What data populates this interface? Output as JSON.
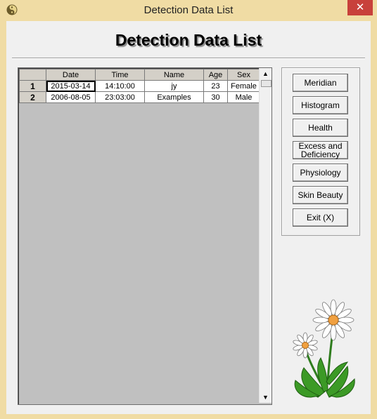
{
  "window": {
    "title": "Detection Data List",
    "close_glyph": "✕"
  },
  "heading": "Detection Data List",
  "grid": {
    "columns": [
      "",
      "Date",
      "Time",
      "Name",
      "Age",
      "Sex"
    ],
    "rows": [
      {
        "num": "1",
        "date": "2015-03-14",
        "time": "14:10:00",
        "name": "jy",
        "age": "23",
        "sex": "Female"
      },
      {
        "num": "2",
        "date": "2006-08-05",
        "time": "23:03:00",
        "name": "Examples",
        "age": "30",
        "sex": "Male"
      }
    ]
  },
  "buttons": [
    {
      "label": "Meridian"
    },
    {
      "label": "Histogram"
    },
    {
      "label": "Health"
    },
    {
      "label": "Excess and Deficiency"
    },
    {
      "label": "Physiology"
    },
    {
      "label": "Skin Beauty"
    },
    {
      "label": "Exit (X)"
    }
  ],
  "icons": {
    "app": "yin-yang-icon",
    "decor": "daisy-flower-icon"
  }
}
